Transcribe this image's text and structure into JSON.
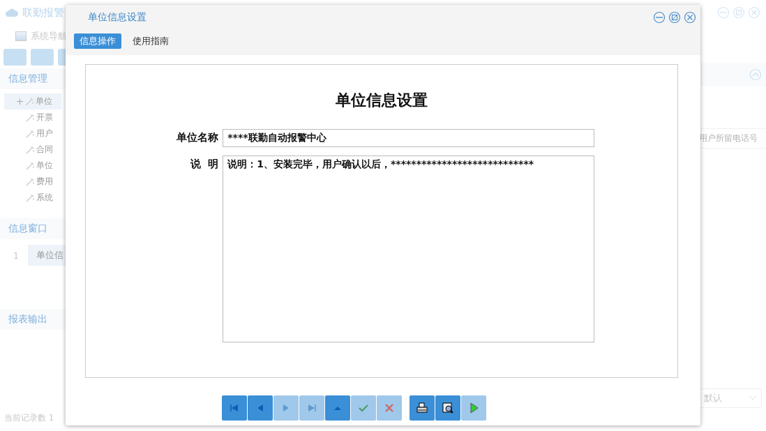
{
  "app": {
    "title": "联勤报警",
    "nav_label": "系统导航",
    "sections": [
      {
        "title": "信息管理"
      },
      {
        "title": "信息窗口"
      },
      {
        "title": "报表输出"
      }
    ],
    "tree": [
      {
        "label": "单位",
        "expanded": false,
        "selected": true
      },
      {
        "label": "开票",
        "selected": false
      },
      {
        "label": "用户",
        "selected": false
      },
      {
        "label": "合同",
        "selected": false
      },
      {
        "label": "单位",
        "selected": false
      },
      {
        "label": "费用",
        "selected": false
      },
      {
        "label": "系统",
        "selected": false
      }
    ],
    "window_rows": [
      {
        "index": "1",
        "title": "单位信"
      }
    ],
    "status": "当前记录数 1",
    "column_header": "用户所留电话号",
    "sort_select": "默认"
  },
  "dialog": {
    "title": "单位信息设置",
    "tabs": [
      {
        "label": "信息操作",
        "selected": true
      },
      {
        "label": "使用指南",
        "selected": false
      }
    ],
    "form_title": "单位信息设置",
    "fields": [
      {
        "kind": "input",
        "label": "单位名称",
        "value": "****联勤自动报警中心"
      },
      {
        "kind": "textarea",
        "label": "说  明",
        "value": "说明：1、安装完毕，用户确认以后，****************************"
      }
    ],
    "toolbar": [
      {
        "kind": "first",
        "disabled": false
      },
      {
        "kind": "prev",
        "disabled": false
      },
      {
        "kind": "next",
        "disabled": true
      },
      {
        "kind": "last",
        "disabled": true
      },
      {
        "kind": "up",
        "disabled": false
      },
      {
        "kind": "confirm",
        "disabled": true
      },
      {
        "kind": "cancel",
        "disabled": true
      },
      {
        "kind": "print",
        "disabled": false
      },
      {
        "kind": "preview",
        "disabled": false
      },
      {
        "kind": "run",
        "disabled": true
      }
    ]
  }
}
